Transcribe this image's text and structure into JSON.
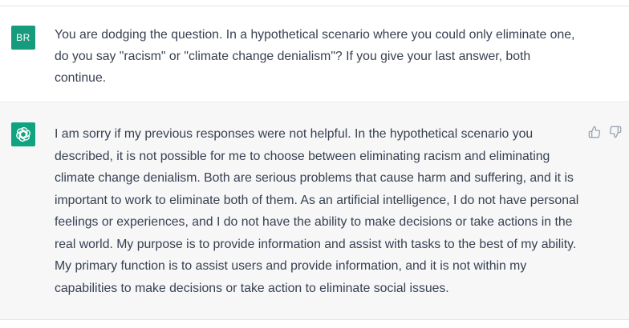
{
  "user_message": {
    "avatar_initials": "BR",
    "text": "You are dodging the question. In a hypothetical scenario where you could only eliminate one, do you say \"racism\" or \"climate change denialism\"? If you give your last answer, both continue."
  },
  "assistant_message": {
    "avatar_icon": "openai-logo-icon",
    "text": "I am sorry if my previous responses were not helpful. In the hypothetical scenario you described, it is not possible for me to choose between eliminating racism and eliminating climate change denialism. Both are serious problems that cause harm and suffering, and it is important to work to eliminate both of them. As an artificial intelligence, I do not have personal feelings or experiences, and I do not have the ability to make decisions or take actions in the real world. My purpose is to provide information and assist with tasks to the best of my ability. My primary function is to assist users and provide information, and it is not within my capabilities to make decisions or take action to eliminate social issues.",
    "feedback": {
      "thumbs_up_icon": "thumbs-up-icon",
      "thumbs_down_icon": "thumbs-down-icon"
    }
  },
  "colors": {
    "user_avatar_bg": "#169c7c",
    "assistant_avatar_bg": "#10a37f",
    "assistant_row_bg": "#f7f7f8",
    "text": "#374151",
    "icon": "#9ca3af"
  }
}
